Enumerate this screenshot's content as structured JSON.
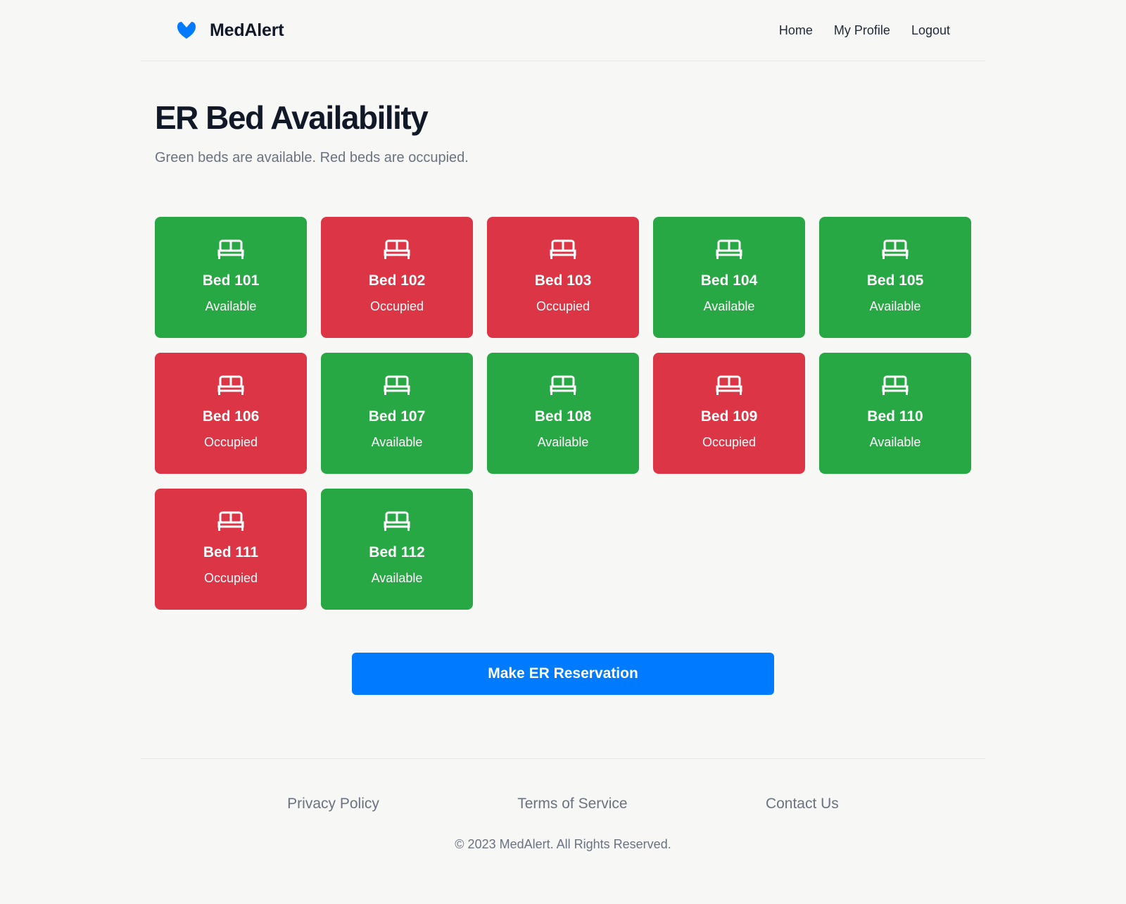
{
  "header": {
    "brand": "MedAlert",
    "logo_icon": "heart-icon",
    "brand_color": "#007bff",
    "nav": [
      {
        "label": "Home"
      },
      {
        "label": "My Profile"
      },
      {
        "label": "Logout"
      }
    ]
  },
  "main": {
    "title": "ER Bed Availability",
    "subtitle": "Green beds are available. Red beds are occupied.",
    "bed_icon": "bed-icon",
    "colors": {
      "available": "#28a745",
      "occupied": "#dc3545"
    },
    "beds": [
      {
        "name": "Bed 101",
        "status": "Available"
      },
      {
        "name": "Bed 102",
        "status": "Occupied"
      },
      {
        "name": "Bed 103",
        "status": "Occupied"
      },
      {
        "name": "Bed 104",
        "status": "Available"
      },
      {
        "name": "Bed 105",
        "status": "Available"
      },
      {
        "name": "Bed 106",
        "status": "Occupied"
      },
      {
        "name": "Bed 107",
        "status": "Available"
      },
      {
        "name": "Bed 108",
        "status": "Available"
      },
      {
        "name": "Bed 109",
        "status": "Occupied"
      },
      {
        "name": "Bed 110",
        "status": "Available"
      },
      {
        "name": "Bed 111",
        "status": "Occupied"
      },
      {
        "name": "Bed 112",
        "status": "Available"
      }
    ],
    "reserve_button": "Make ER Reservation"
  },
  "footer": {
    "links": [
      {
        "label": "Privacy Policy"
      },
      {
        "label": "Terms of Service"
      },
      {
        "label": "Contact Us"
      }
    ],
    "copyright": "© 2023 MedAlert. All Rights Reserved."
  }
}
